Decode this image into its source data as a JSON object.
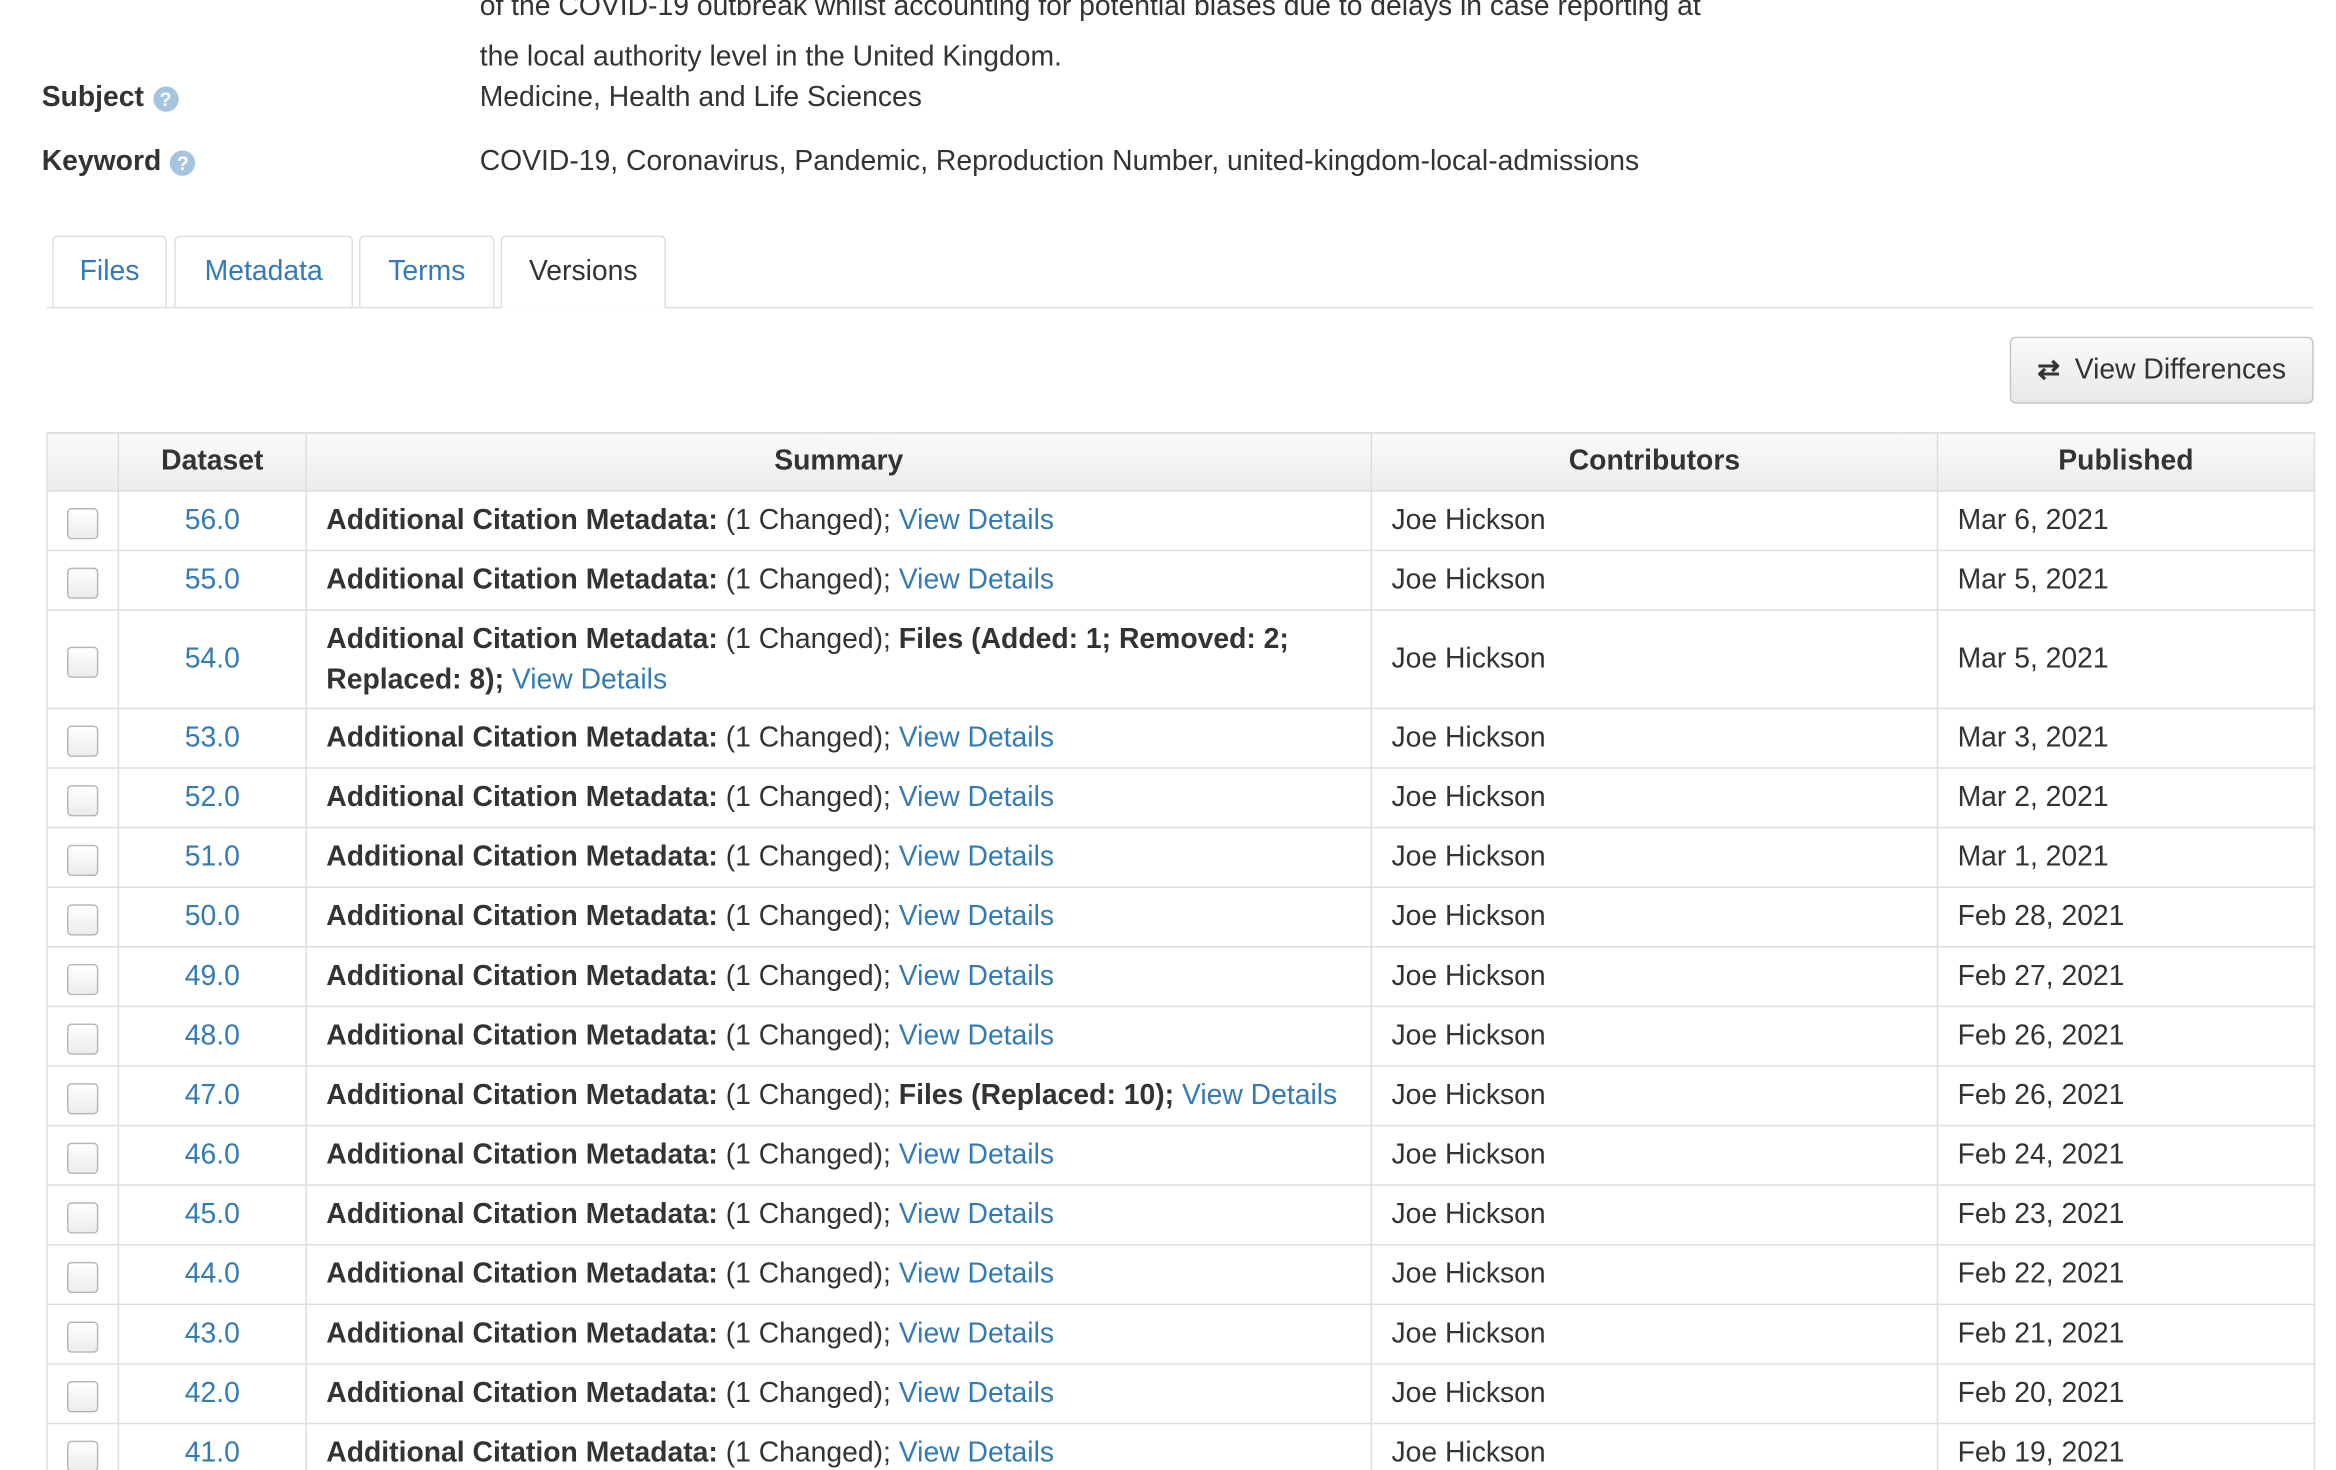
{
  "description": {
    "line_fragment": "of the COVID-19 outbreak whilst accounting for potential biases due to delays in case reporting at",
    "last_line": "the local authority level in the United Kingdom."
  },
  "subject": {
    "label": "Subject",
    "value": "Medicine, Health and Life Sciences"
  },
  "keyword": {
    "label": "Keyword",
    "value": "COVID-19, Coronavirus, Pandemic, Reproduction Number, united-kingdom-local-admissions"
  },
  "help_icon_glyph": "?",
  "tabs": [
    {
      "label": "Files",
      "active": false
    },
    {
      "label": "Metadata",
      "active": false
    },
    {
      "label": "Terms",
      "active": false
    },
    {
      "label": "Versions",
      "active": true
    }
  ],
  "view_differences": {
    "label": "View Differences",
    "icon": "swap-arrows-icon"
  },
  "table": {
    "headers": [
      "",
      "Dataset",
      "Summary",
      "Contributors",
      "Published"
    ],
    "rows": [
      {
        "version": "56.0",
        "meta": "Additional Citation Metadata:",
        "changed": " (1 Changed);",
        "files": "",
        "link": "View Details",
        "contributor": "Joe Hickson",
        "published": "Mar 6, 2021"
      },
      {
        "version": "55.0",
        "meta": "Additional Citation Metadata:",
        "changed": " (1 Changed);",
        "files": "",
        "link": "View Details",
        "contributor": "Joe Hickson",
        "published": "Mar 5, 2021"
      },
      {
        "version": "54.0",
        "meta": "Additional Citation Metadata:",
        "changed": " (1 Changed);",
        "files": "Files (Added: 1; Removed: 2; Replaced: 8);",
        "link": "View Details",
        "contributor": "Joe Hickson",
        "published": "Mar 5, 2021"
      },
      {
        "version": "53.0",
        "meta": "Additional Citation Metadata:",
        "changed": " (1 Changed);",
        "files": "",
        "link": "View Details",
        "contributor": "Joe Hickson",
        "published": "Mar 3, 2021"
      },
      {
        "version": "52.0",
        "meta": "Additional Citation Metadata:",
        "changed": " (1 Changed);",
        "files": "",
        "link": "View Details",
        "contributor": "Joe Hickson",
        "published": "Mar 2, 2021"
      },
      {
        "version": "51.0",
        "meta": "Additional Citation Metadata:",
        "changed": " (1 Changed);",
        "files": "",
        "link": "View Details",
        "contributor": "Joe Hickson",
        "published": "Mar 1, 2021"
      },
      {
        "version": "50.0",
        "meta": "Additional Citation Metadata:",
        "changed": " (1 Changed);",
        "files": "",
        "link": "View Details",
        "contributor": "Joe Hickson",
        "published": "Feb 28, 2021"
      },
      {
        "version": "49.0",
        "meta": "Additional Citation Metadata:",
        "changed": " (1 Changed);",
        "files": "",
        "link": "View Details",
        "contributor": "Joe Hickson",
        "published": "Feb 27, 2021"
      },
      {
        "version": "48.0",
        "meta": "Additional Citation Metadata:",
        "changed": " (1 Changed);",
        "files": "",
        "link": "View Details",
        "contributor": "Joe Hickson",
        "published": "Feb 26, 2021"
      },
      {
        "version": "47.0",
        "meta": "Additional Citation Metadata:",
        "changed": " (1 Changed);",
        "files": "Files (Replaced: 10);",
        "link": "View Details",
        "contributor": "Joe Hickson",
        "published": "Feb 26, 2021"
      },
      {
        "version": "46.0",
        "meta": "Additional Citation Metadata:",
        "changed": " (1 Changed);",
        "files": "",
        "link": "View Details",
        "contributor": "Joe Hickson",
        "published": "Feb 24, 2021"
      },
      {
        "version": "45.0",
        "meta": "Additional Citation Metadata:",
        "changed": " (1 Changed);",
        "files": "",
        "link": "View Details",
        "contributor": "Joe Hickson",
        "published": "Feb 23, 2021"
      },
      {
        "version": "44.0",
        "meta": "Additional Citation Metadata:",
        "changed": " (1 Changed);",
        "files": "",
        "link": "View Details",
        "contributor": "Joe Hickson",
        "published": "Feb 22, 2021"
      },
      {
        "version": "43.0",
        "meta": "Additional Citation Metadata:",
        "changed": " (1 Changed);",
        "files": "",
        "link": "View Details",
        "contributor": "Joe Hickson",
        "published": "Feb 21, 2021"
      },
      {
        "version": "42.0",
        "meta": "Additional Citation Metadata:",
        "changed": " (1 Changed);",
        "files": "",
        "link": "View Details",
        "contributor": "Joe Hickson",
        "published": "Feb 20, 2021"
      },
      {
        "version": "41.0",
        "meta": "Additional Citation Metadata:",
        "changed": " (1 Changed);",
        "files": "",
        "link": "View Details",
        "contributor": "Joe Hickson",
        "published": "Feb 19, 2021"
      }
    ]
  },
  "colors": {
    "link": "#337ab7",
    "text": "#333333",
    "border": "#dddddd",
    "help_icon": "#a6c4dd"
  }
}
